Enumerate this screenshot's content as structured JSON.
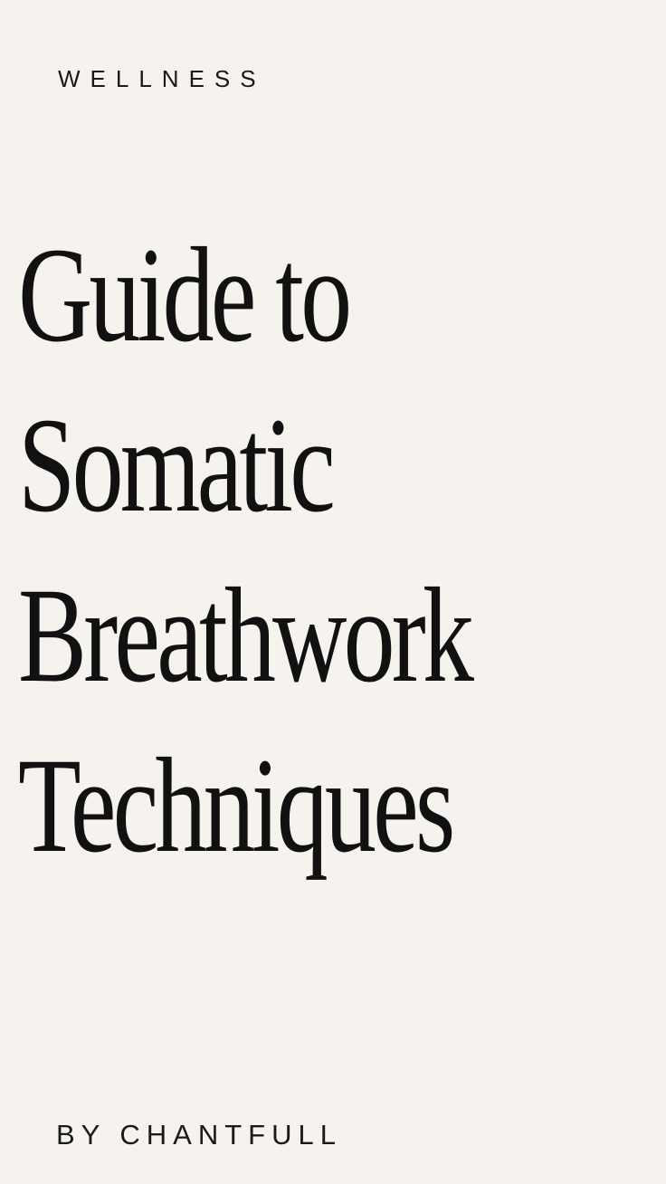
{
  "category_label": "WELLNESS",
  "title_lines": [
    "Guide to",
    "Somatic",
    "Breathwork",
    "Techniques"
  ],
  "byline": "BY CHANTFULL",
  "colors": {
    "background": "#f6f3ef",
    "text": "#111111"
  }
}
